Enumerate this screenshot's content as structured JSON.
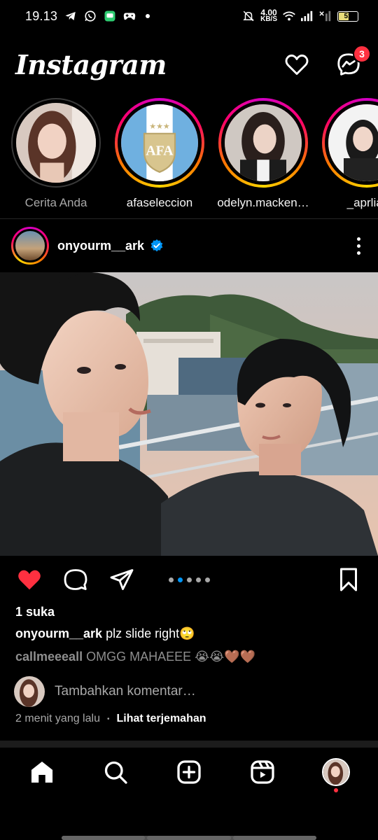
{
  "status_bar": {
    "time": "19.13",
    "net_speed_value": "4.00",
    "net_speed_unit": "KB/S",
    "battery": "51",
    "icons": [
      "telegram-icon",
      "whatsapp-icon",
      "messages-icon",
      "gamepad-icon",
      "dot-icon",
      "mute-icon",
      "wifi-icon",
      "signal-icon",
      "signal-x-icon",
      "battery-icon"
    ]
  },
  "header": {
    "logo": "Instagram",
    "messenger_badge": "3"
  },
  "stories": [
    {
      "label": "Cerita Anda",
      "seen": true,
      "icon": "avatar"
    },
    {
      "label": "afaseleccion",
      "seen": false,
      "icon": "afa-logo"
    },
    {
      "label": "odelyn.macken…",
      "seen": false,
      "icon": "avatar"
    },
    {
      "label": "_aprliar",
      "seen": false,
      "icon": "avatar"
    }
  ],
  "post": {
    "username": "onyourm__ark",
    "verified": true,
    "carousel": {
      "count": 5,
      "active": 2
    },
    "likes": "1 suka",
    "caption_user": "onyourm__ark",
    "caption_text": " plz slide right🙄",
    "comment_user": "callmeeeall",
    "comment_text": " OMGG MAHAEEE 😭😭🤎🤎",
    "add_comment_placeholder": "Tambahkan komentar…",
    "time_ago": "2 menit yang lalu",
    "separator": "•",
    "translate_label": "Lihat terjemahan"
  },
  "colors": {
    "background": "#000000",
    "like_red": "#ff3040",
    "accent_blue": "#0095f6",
    "muted_text": "#a8a8a8"
  },
  "bottom_nav": [
    "home-icon",
    "search-icon",
    "create-icon",
    "reels-icon",
    "profile-avatar"
  ]
}
